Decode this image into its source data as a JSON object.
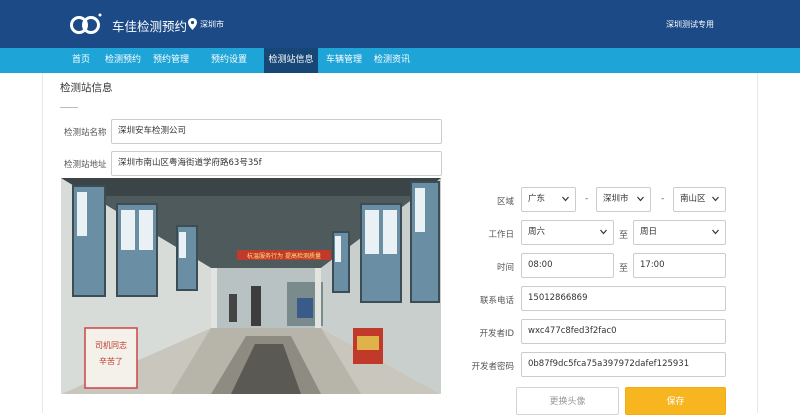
{
  "header": {
    "brand": "车佳检测预约",
    "city": "深圳市",
    "user": "深圳测试专用"
  },
  "nav": {
    "items": [
      {
        "label": "首页"
      },
      {
        "label": "检测预约"
      },
      {
        "label": "预约管理"
      },
      {
        "label": "预约设置"
      },
      {
        "label": "检测站信息",
        "active": true
      },
      {
        "label": "车辆管理"
      },
      {
        "label": "检测资讯"
      }
    ]
  },
  "page": {
    "title": "检测站信息"
  },
  "form": {
    "name_label": "检测站名称",
    "name_value": "深圳安车检测公司",
    "address_label": "检测站地址",
    "address_value": "深圳市南山区粤海街道学府路63号35f",
    "region_label": "区域",
    "province": "广东",
    "city": "深圳市",
    "district": "南山区",
    "workday_label": "工作日",
    "workday_from": "周六",
    "workday_to": "周日",
    "to_label": "至",
    "time_label": "时间",
    "time_from": "08:00",
    "time_to": "17:00",
    "phone_label": "联系电话",
    "phone_value": "15012866869",
    "devid_label": "开发者ID",
    "devid_value": "wxc477c8fed3f2fac0",
    "devsecret_label": "开发者密码",
    "devsecret_value": "0b87f9dc5fca75a397972dafef125931"
  },
  "photo": {
    "banner_text": "杭温服务行为 提高检测质量",
    "sign_text": "司机同志 辛苦了"
  },
  "buttons": {
    "change_photo": "更换头像",
    "save": "保存"
  },
  "colors": {
    "header_bg": "#1b4a86",
    "nav_bg": "#1fa4d8",
    "nav_active": "#174777",
    "save_btn": "#f7b51f"
  }
}
